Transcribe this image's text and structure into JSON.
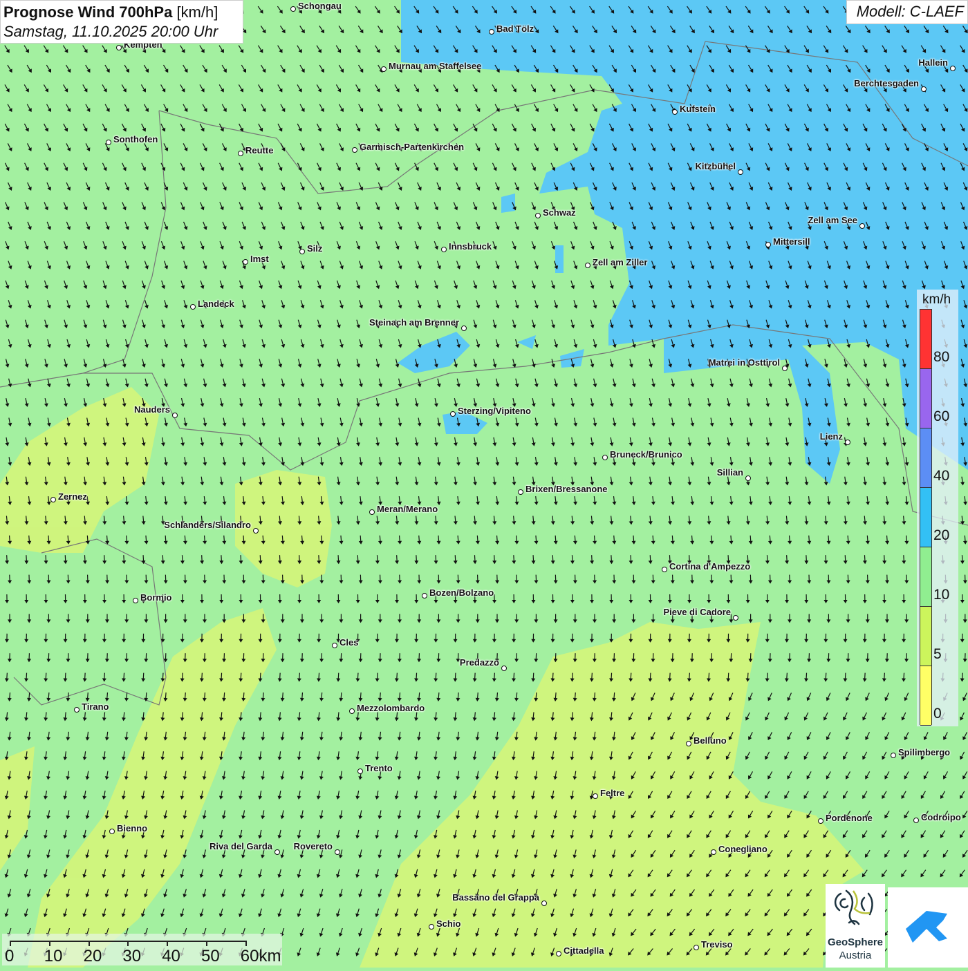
{
  "title": {
    "main": "Prognose Wind 700hPa",
    "unit": "[km/h]",
    "datetime": "Samstag, 11.10.2025 20:00 Uhr"
  },
  "model": "Modell: C-LAEF",
  "legend": {
    "unit": "km/h",
    "ticks": [
      "80",
      "60",
      "40",
      "20",
      "10",
      "5",
      "0"
    ],
    "colors": [
      "#ff3333",
      "#9966ee",
      "#5c8ef5",
      "#33c0f5",
      "#90ee90",
      "#ccf55c",
      "#ffff66"
    ]
  },
  "scale_bar": {
    "labels": [
      "0",
      "10",
      "20",
      "30",
      "40",
      "50",
      "60km"
    ]
  },
  "logos": {
    "geosphere_line1": "GeoSphere",
    "geosphere_line2": "Austria"
  },
  "colors": {
    "green": "#a3f0a0",
    "blue": "#5cc8f5",
    "yellow": "#d4f57a",
    "arrow": "#111111"
  },
  "cities": [
    "Schongau",
    "Bad Tölz",
    "Kempten",
    "Murnau am Staffelsee",
    "Hallein",
    "Berchtesgaden",
    "Kufstein",
    "Sonthofen",
    "Reutte",
    "Garmisch-Partenkirchen",
    "Kitzbühel",
    "Schwaz",
    "Zell am See",
    "Innsbruck",
    "Silz",
    "Mittersill",
    "Imst",
    "Zell am Ziller",
    "Landeck",
    "Steinach am Brenner",
    "Matrei in Osttirol",
    "Nauders",
    "Sterzing/Vipiteno",
    "Lienz",
    "Bruneck/Brunico",
    "Sillian",
    "Brixen/Bressanone",
    "Zernez",
    "Meran/Merano",
    "Schlanders/Silandro",
    "Cortina d'Ampezzo",
    "Bozen/Bolzano",
    "Bormio",
    "Pieve di Cadore",
    "Cles",
    "Predazzo",
    "Tirano",
    "Mezzolombardo",
    "Belluno",
    "Spilimbergo",
    "Trento",
    "Feltre",
    "Pordenone",
    "Codroipo",
    "Bienno",
    "Riva del Garda",
    "Rovereto",
    "Conegliano",
    "Bassano del Grappa",
    "Schio",
    "Treviso",
    "Cittadella"
  ]
}
